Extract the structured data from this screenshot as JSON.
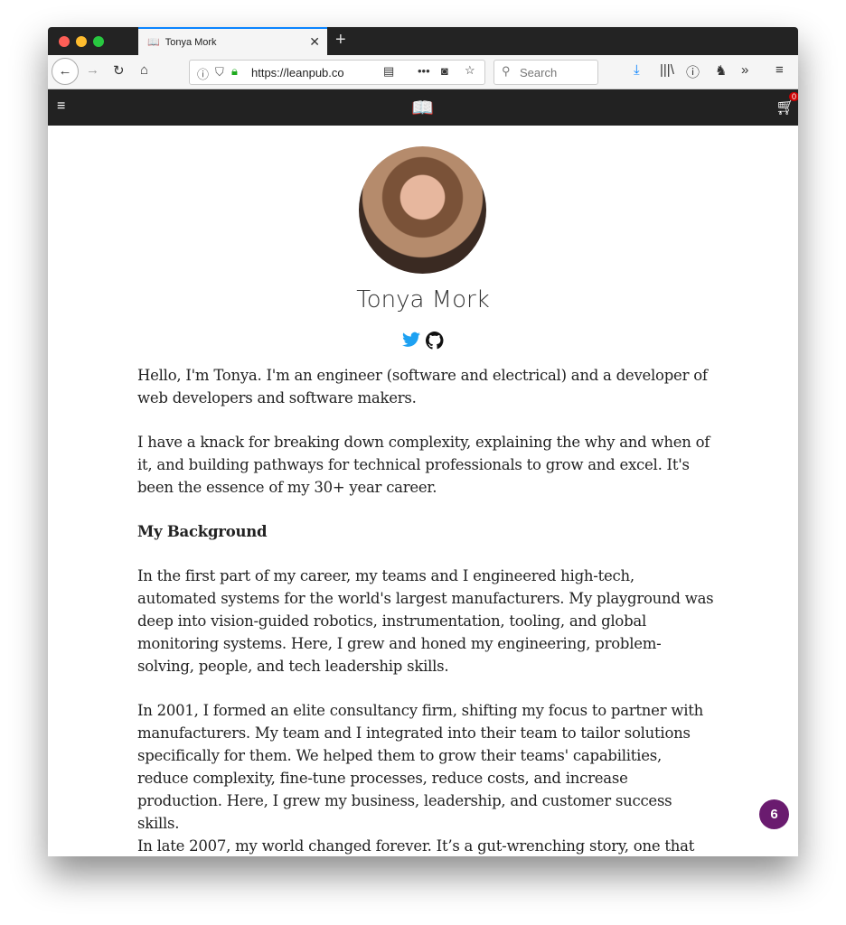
{
  "browser": {
    "tab_title": "Tonya Mork",
    "url": "https://leanpub.co",
    "search_placeholder": "Search"
  },
  "site": {
    "cart_count": "0"
  },
  "profile": {
    "name": "Tonya Mork"
  },
  "paragraphs": [
    {
      "text": "Hello, I'm Tonya. I'm an engineer (software and electrical) and a developer of web developers and software makers."
    },
    {
      "text": "I have a knack for breaking down complexity, explaining the why and when of it, and building pathways for technical professionals to grow and excel. It's been the essence of my 30+ year career."
    },
    {
      "text": "My Background",
      "bold": true
    },
    {
      "text": "In the first part of my career, my teams and I engineered high-tech, automated systems for the world's largest manufacturers. My playground was deep into vision-guided robotics, instrumentation, tooling, and global monitoring systems. Here, I grew and honed my engineering, problem-solving, people, and tech leadership skills."
    },
    {
      "text": "In 2001, I formed an elite consultancy firm, shifting my focus to partner with manufacturers. My team and I integrated into their team to tailor solutions specifically for them. We helped them to grow their teams' capabilities, reduce complexity, fine-tune processes, reduce costs, and increase production. Here, I grew my business, leadership, and customer success skills."
    },
    {
      "text": "In late 2007, my world changed forever. It’s a gut-wrenching story, one that"
    }
  ],
  "notification_count": "6",
  "colors": {
    "twitter": "#1da1f2",
    "badge": "#6a1b6f",
    "tab_accent": "#0a84ff"
  }
}
